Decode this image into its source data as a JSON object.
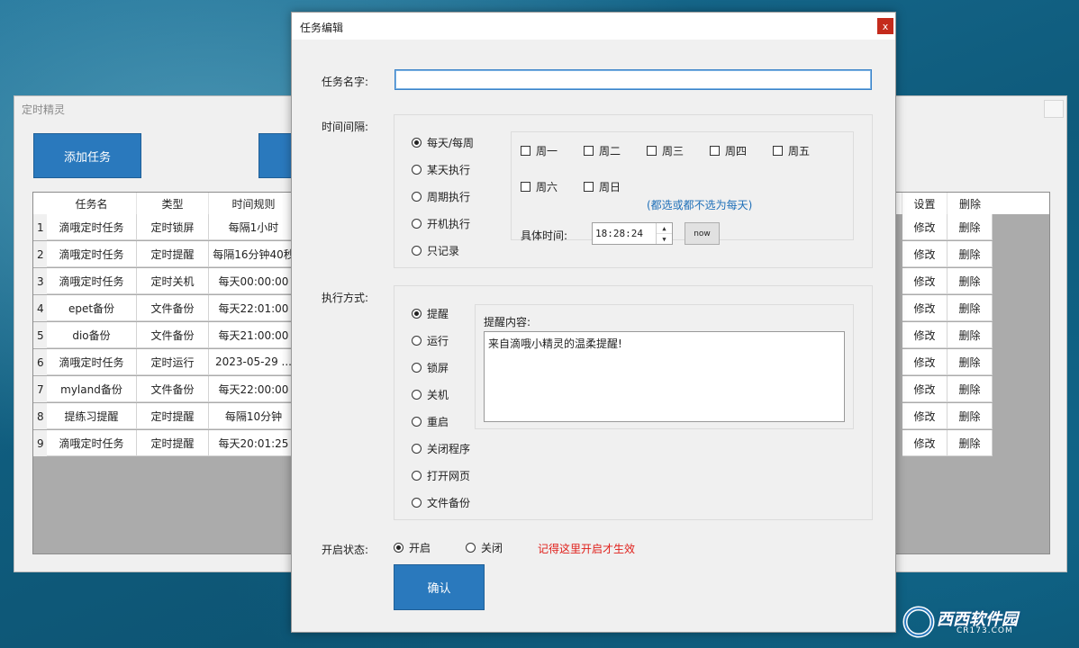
{
  "main_window": {
    "title": "定时精灵",
    "add_task_label": "添加任务",
    "columns_left": [
      "任务名",
      "类型",
      "时间规则"
    ],
    "columns_right": [
      "设置",
      "删除"
    ],
    "rows": [
      {
        "no": "1",
        "name": "滴哦定时任务",
        "type": "定时锁屏",
        "rule": "每隔1小时",
        "set": "修改",
        "del": "删除"
      },
      {
        "no": "2",
        "name": "滴哦定时任务",
        "type": "定时提醒",
        "rule": "每隔16分钟40秒",
        "set": "修改",
        "del": "删除"
      },
      {
        "no": "3",
        "name": "滴哦定时任务",
        "type": "定时关机",
        "rule": "每天00:00:00",
        "set": "修改",
        "del": "删除"
      },
      {
        "no": "4",
        "name": "epet备份",
        "type": "文件备份",
        "rule": "每天22:01:00",
        "set": "修改",
        "del": "删除"
      },
      {
        "no": "5",
        "name": "dio备份",
        "type": "文件备份",
        "rule": "每天21:00:00",
        "set": "修改",
        "del": "删除"
      },
      {
        "no": "6",
        "name": "滴哦定时任务",
        "type": "定时运行",
        "rule": "2023-05-29 ...",
        "set": "修改",
        "del": "删除"
      },
      {
        "no": "7",
        "name": "myland备份",
        "type": "文件备份",
        "rule": "每天22:00:00",
        "set": "修改",
        "del": "删除"
      },
      {
        "no": "8",
        "name": "提练习提醒",
        "type": "定时提醒",
        "rule": "每隔10分钟",
        "set": "修改",
        "del": "删除"
      },
      {
        "no": "9",
        "name": "滴哦定时任务",
        "type": "定时提醒",
        "rule": "每天20:01:25",
        "set": "修改",
        "del": "删除"
      }
    ]
  },
  "dialog": {
    "title": "任务编辑",
    "close_glyph": "x",
    "task_name_label": "任务名字:",
    "task_name_value": "",
    "interval_label": "时间间隔:",
    "interval_options": [
      "每天/每周",
      "某天执行",
      "周期执行",
      "开机执行",
      "只记录"
    ],
    "interval_selected": 0,
    "weekdays": [
      "周一",
      "周二",
      "周三",
      "周四",
      "周五",
      "周六",
      "周日"
    ],
    "weekday_hint": "(都选或都不选为每天)",
    "specific_time_label": "具体时间:",
    "time_value": "18:28:24",
    "now_label": "now",
    "exec_label": "执行方式:",
    "exec_options": [
      "提醒",
      "运行",
      "锁屏",
      "关机",
      "重启",
      "关闭程序",
      "打开网页",
      "文件备份"
    ],
    "exec_selected": 0,
    "remind_content_label": "提醒内容:",
    "remind_content_value": "来自滴哦小精灵的温柔提醒!",
    "enable_label": "开启状态:",
    "enable_on": "开启",
    "enable_off": "关闭",
    "enable_hint": "记得这里开启才生效",
    "confirm_label": "确认"
  },
  "watermark": {
    "brand": "西西软件园",
    "url": "CR173.COM"
  },
  "colors": {
    "accent_blue": "#2a79bd",
    "hint_blue": "#1e6fb8",
    "hint_red": "#e0201b",
    "close_red": "#c42b1c"
  }
}
